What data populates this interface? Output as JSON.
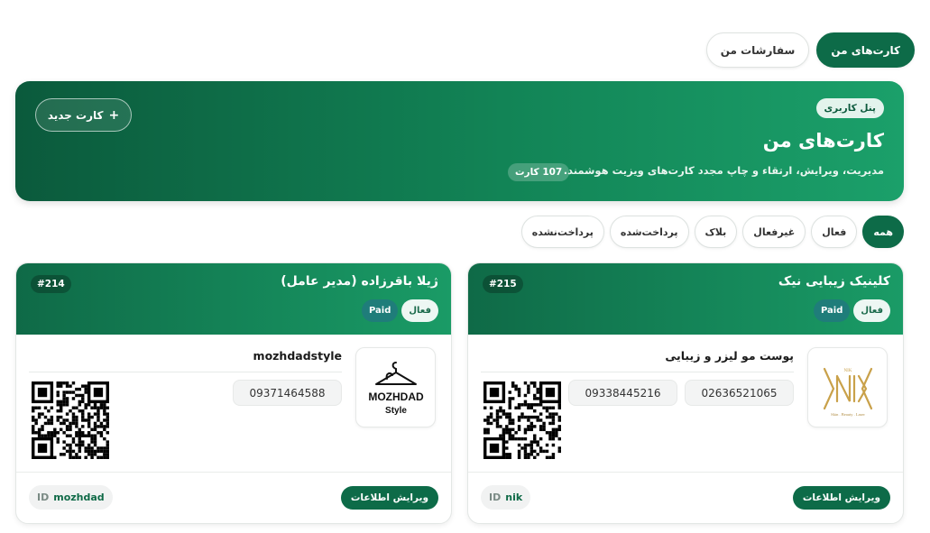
{
  "tabs": [
    {
      "label": "کارت‌های من",
      "active": true
    },
    {
      "label": "سفارشات من",
      "active": false
    }
  ],
  "hero": {
    "badge": "پنل کاربری",
    "title": "کارت‌های من",
    "description": "مدیریت، ویرایش، ارتقاء و چاپ مجدد کارت‌های ویزیت هوشمند.",
    "count": "107 کارت",
    "new_card_label": "کارت جدید",
    "new_card_icon": "+"
  },
  "filters": [
    {
      "label": "همه",
      "active": true
    },
    {
      "label": "فعال",
      "active": false
    },
    {
      "label": "غیرفعال",
      "active": false
    },
    {
      "label": "بلاک",
      "active": false
    },
    {
      "label": "پرداخت‌شده",
      "active": false
    },
    {
      "label": "پرداخت‌نشده",
      "active": false
    }
  ],
  "cards": [
    {
      "title": "کلینیک زیبایی نیک",
      "number": "#215",
      "status": "فعال",
      "payment": "Paid",
      "subtitle": "پوست مو لیزر و زیبایی",
      "phones": [
        "02636521065",
        "09338445216"
      ],
      "logo": "nik-logo",
      "id_value": "nik",
      "id_label": "ID",
      "edit_label": "ویرایش اطلاعات"
    },
    {
      "title": "ژیلا باقرزاده (مدیر عامل)",
      "number": "#214",
      "status": "فعال",
      "payment": "Paid",
      "subtitle": "mozhdadstyle",
      "phones": [
        "09371464588"
      ],
      "logo": "mozhdad-logo",
      "logo_text": [
        "MOZHDAD",
        "Style"
      ],
      "id_value": "mozhdad",
      "id_label": "ID",
      "edit_label": "ویرایش اطلاعات"
    }
  ],
  "colors": {
    "primary": "#0d6b48",
    "paid_badge": "#1f7d7a",
    "nik_gold": "#c9a14a"
  }
}
